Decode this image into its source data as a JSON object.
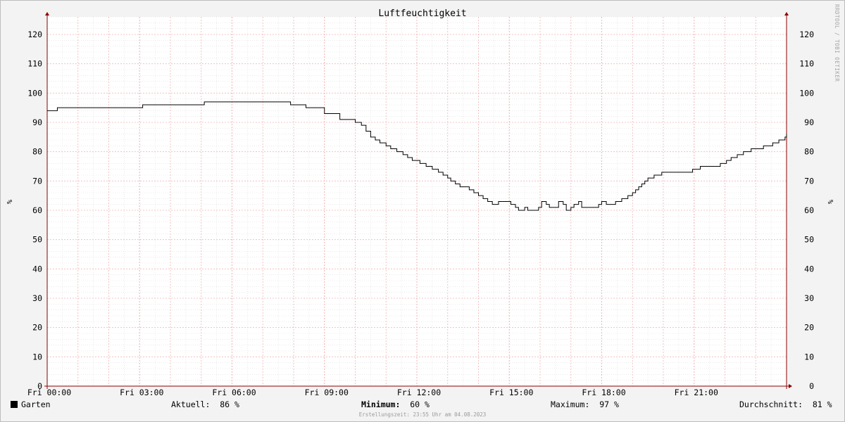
{
  "chart_data": {
    "type": "line",
    "title": "Luftfeuchtigkeit",
    "ylabel": "%",
    "ylim": [
      0,
      126
    ],
    "yticks": [
      0,
      10,
      20,
      30,
      40,
      50,
      60,
      70,
      80,
      90,
      100,
      110,
      120
    ],
    "xlim": [
      0,
      24
    ],
    "xticks": [
      {
        "hour": 0,
        "label": "Fri 00:00"
      },
      {
        "hour": 3,
        "label": "Fri 03:00"
      },
      {
        "hour": 6,
        "label": "Fri 06:00"
      },
      {
        "hour": 9,
        "label": "Fri 09:00"
      },
      {
        "hour": 12,
        "label": "Fri 12:00"
      },
      {
        "hour": 15,
        "label": "Fri 15:00"
      },
      {
        "hour": 18,
        "label": "Fri 18:00"
      },
      {
        "hour": 21,
        "label": "Fri 21:00"
      }
    ],
    "grid": true,
    "series": [
      {
        "name": "Garten",
        "color": "#000000",
        "points": [
          [
            0,
            94
          ],
          [
            0.33,
            95
          ],
          [
            3.1,
            96
          ],
          [
            5.1,
            97
          ],
          [
            7.9,
            96
          ],
          [
            8.4,
            95
          ],
          [
            9.0,
            93
          ],
          [
            9.5,
            91
          ],
          [
            10.0,
            90
          ],
          [
            10.2,
            89
          ],
          [
            10.35,
            87
          ],
          [
            10.5,
            85
          ],
          [
            10.65,
            84
          ],
          [
            10.8,
            83
          ],
          [
            11.0,
            82
          ],
          [
            11.15,
            81
          ],
          [
            11.35,
            80
          ],
          [
            11.55,
            79
          ],
          [
            11.7,
            78
          ],
          [
            11.85,
            77
          ],
          [
            12.1,
            76
          ],
          [
            12.3,
            75
          ],
          [
            12.5,
            74
          ],
          [
            12.7,
            73
          ],
          [
            12.85,
            72
          ],
          [
            13.0,
            71
          ],
          [
            13.1,
            70
          ],
          [
            13.25,
            69
          ],
          [
            13.4,
            68
          ],
          [
            13.7,
            67
          ],
          [
            13.85,
            66
          ],
          [
            14.0,
            65
          ],
          [
            14.15,
            64
          ],
          [
            14.3,
            63
          ],
          [
            14.45,
            62
          ],
          [
            14.6,
            62
          ],
          [
            14.65,
            63
          ],
          [
            15.05,
            62
          ],
          [
            15.2,
            61
          ],
          [
            15.3,
            60
          ],
          [
            15.5,
            61
          ],
          [
            15.6,
            60
          ],
          [
            15.95,
            61
          ],
          [
            16.05,
            63
          ],
          [
            16.2,
            62
          ],
          [
            16.3,
            61
          ],
          [
            16.6,
            63
          ],
          [
            16.75,
            62
          ],
          [
            16.85,
            60
          ],
          [
            17.0,
            61
          ],
          [
            17.1,
            62
          ],
          [
            17.25,
            63
          ],
          [
            17.35,
            61
          ],
          [
            17.9,
            62
          ],
          [
            18.0,
            63
          ],
          [
            18.15,
            62
          ],
          [
            18.45,
            63
          ],
          [
            18.65,
            64
          ],
          [
            18.85,
            65
          ],
          [
            19.0,
            66
          ],
          [
            19.1,
            67
          ],
          [
            19.2,
            68
          ],
          [
            19.3,
            69
          ],
          [
            19.4,
            70
          ],
          [
            19.5,
            71
          ],
          [
            19.7,
            72
          ],
          [
            19.95,
            73
          ],
          [
            20.95,
            74
          ],
          [
            21.2,
            75
          ],
          [
            21.85,
            76
          ],
          [
            22.05,
            77
          ],
          [
            22.2,
            78
          ],
          [
            22.4,
            79
          ],
          [
            22.6,
            80
          ],
          [
            22.85,
            81
          ],
          [
            23.25,
            82
          ],
          [
            23.55,
            83
          ],
          [
            23.75,
            84
          ],
          [
            23.95,
            85
          ],
          [
            24.2,
            86
          ],
          [
            24.45,
            86
          ]
        ]
      }
    ]
  },
  "legend": {
    "series_name": "Garten",
    "aktuell_label": "Aktuell:",
    "aktuell_value": "86 %",
    "minimum_label": "Minimum:",
    "minimum_value": "60 %",
    "maximum_label": "Maximum:",
    "maximum_value": "97 %",
    "durchschnitt_label": "Durchschnitt:",
    "durchschnitt_value": "81 %"
  },
  "footer": "Erstellungszeit: 23:55 Uhr am 04.08.2023",
  "watermark": "RRDTOOL / TOBI OETIKER"
}
